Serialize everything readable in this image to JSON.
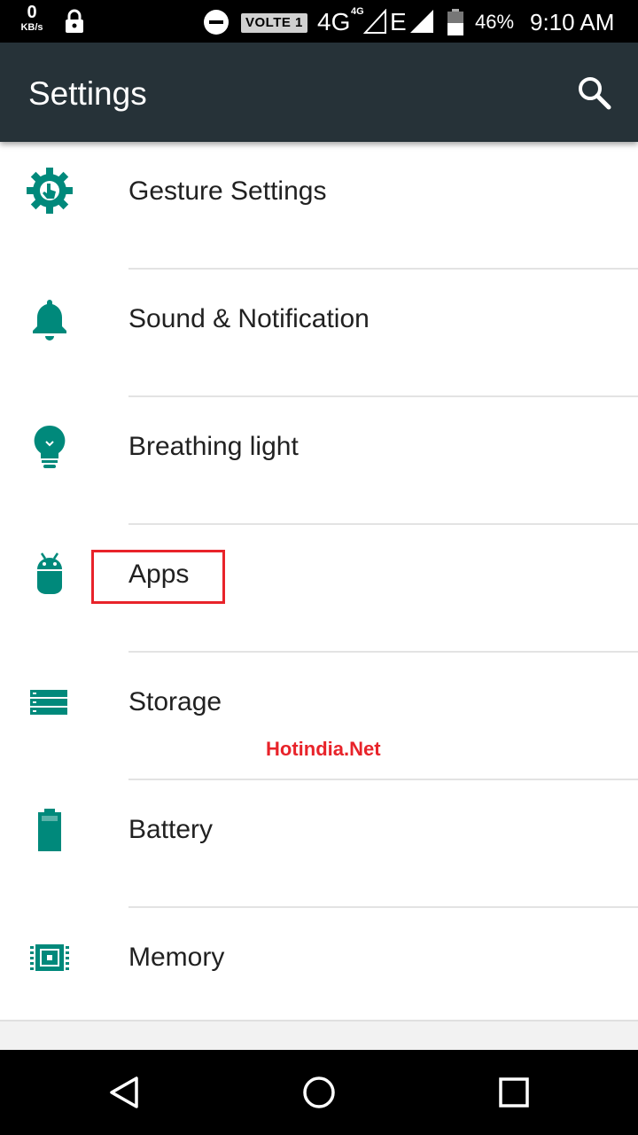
{
  "status_bar": {
    "speed_value": "0",
    "speed_unit": "KB/s",
    "volte": "VOLTE 1",
    "network_4g": "4G",
    "network_4g_sup": "4G",
    "network_e": "E",
    "battery_percent": "46%",
    "time": "9:10 AM"
  },
  "appbar": {
    "title": "Settings",
    "search_icon": "search-icon"
  },
  "settings_items": [
    {
      "label": "Gesture Settings",
      "icon": "gesture-settings-icon"
    },
    {
      "label": "Sound & Notification",
      "icon": "bell-icon"
    },
    {
      "label": "Breathing light",
      "icon": "lightbulb-icon"
    },
    {
      "label": "Apps",
      "icon": "android-icon"
    },
    {
      "label": "Storage",
      "icon": "storage-icon"
    },
    {
      "label": "Battery",
      "icon": "battery-icon"
    },
    {
      "label": "Memory",
      "icon": "memory-chip-icon"
    }
  ],
  "watermark": "Hotindia.Net",
  "colors": {
    "appbar": "#263238",
    "accent": "#009688",
    "highlight": "#e8232a"
  },
  "nav": {
    "back_icon": "back-icon",
    "home_icon": "home-icon",
    "recents_icon": "recents-icon"
  }
}
